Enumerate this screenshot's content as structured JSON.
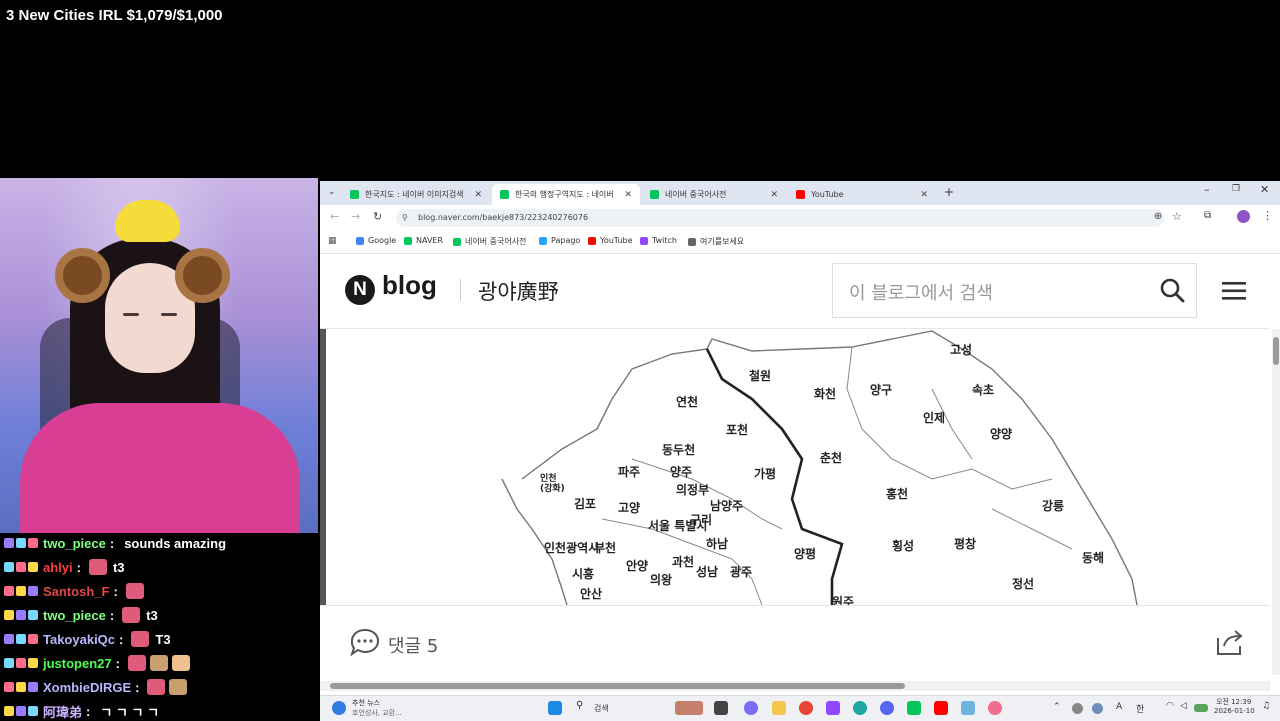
{
  "stream": {
    "title": "3 New Cities IRL $1,079/$1,000"
  },
  "chat": [
    {
      "user": "two_piece",
      "user_color": "#7fff7f",
      "message": "sounds amazing",
      "emotes": 0
    },
    {
      "user": "ahlyi",
      "user_color": "#ff3b3b",
      "message": "t3",
      "emotes": 1
    },
    {
      "user": "Santosh_F",
      "user_color": "#e04848",
      "message": "",
      "emotes": 1
    },
    {
      "user": "two_piece",
      "user_color": "#7fff7f",
      "message": "t3",
      "emotes": 1
    },
    {
      "user": "TakoyakiQc",
      "user_color": "#b7b7ff",
      "message": "T3",
      "emotes": 1
    },
    {
      "user": "justopen27",
      "user_color": "#4cff4c",
      "message": "",
      "emotes": 3
    },
    {
      "user": "XombieDIRGE",
      "user_color": "#b7b7ff",
      "message": "",
      "emotes": 2
    },
    {
      "user": "阿瑋弟",
      "user_color": "#c8b4ff",
      "message": "ㄱ ㄱ ㄱ ㄱ",
      "emotes": 0
    }
  ],
  "browser": {
    "tabs": [
      {
        "label": "한국지도 : 네이버 이미지검색",
        "color": "#03c75a",
        "active": false
      },
      {
        "label": "한국의 행정구역지도 : 네이버",
        "color": "#03c75a",
        "active": true
      },
      {
        "label": "네이버 중국어사전",
        "color": "#03c75a",
        "active": false
      },
      {
        "label": "YouTube",
        "color": "#ff0000",
        "active": false
      }
    ],
    "url": "blog.naver.com/baekje873/223240276076",
    "bookmarks": [
      {
        "label": "Google",
        "color": "#4285f4"
      },
      {
        "label": "NAVER",
        "color": "#03c75a"
      },
      {
        "label": "네이버 중국어사전",
        "color": "#03c75a"
      },
      {
        "label": "Papago",
        "color": "#2aa3ff"
      },
      {
        "label": "YouTube",
        "color": "#ff0000"
      },
      {
        "label": "Twitch",
        "color": "#9146ff"
      },
      {
        "label": "여기를보세요",
        "color": "#666666"
      }
    ]
  },
  "blog": {
    "logo_letter": "N",
    "logo_word": "blog",
    "blog_name": "광야廣野",
    "search_placeholder": "이 블로그에서 검색",
    "comment_label": "댓글 5"
  },
  "map": {
    "labels": [
      "고성",
      "철원",
      "화천",
      "양구",
      "속초",
      "연천",
      "인제",
      "포천",
      "양양",
      "동두천",
      "가평",
      "춘천",
      "인천 (강화)",
      "파주",
      "양주",
      "의정부",
      "홍천",
      "강릉",
      "김포",
      "고양",
      "남양주",
      "서울 특별시",
      "구리",
      "인천광역시",
      "부천",
      "하남",
      "양평",
      "횡성",
      "평창",
      "안양",
      "과천",
      "동해",
      "시흥",
      "성남",
      "광주",
      "의왕",
      "안산",
      "원주",
      "정선"
    ]
  },
  "taskbar": {
    "news_title": "추천 뉴스",
    "news_sub": "호언성사, 교환...",
    "search_label": "검색",
    "lang": "한",
    "ime": "A",
    "time": "오전 12:39",
    "date": "2026-01-10"
  }
}
